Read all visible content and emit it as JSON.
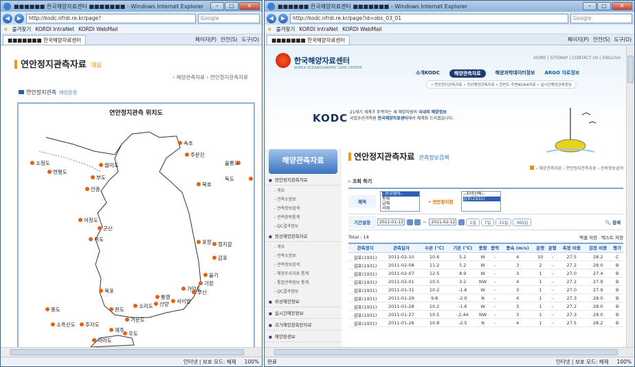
{
  "left_window": {
    "title": "■■■■■■ 한국해양자료센터 ■■■■■■■ - Windows Internet Explorer",
    "url": "http://kodc.nfrdi.re.kr/page?",
    "search_placeholder": "Google",
    "favorites": [
      "즐겨찾기",
      "KORDI IntraNet",
      "KORDI WebMail"
    ],
    "tab_label": "■■■■■■■ 한국해양자료센터",
    "tools": [
      "페이지(P)",
      "안전(S)",
      "도구(O)"
    ],
    "page_title": "연안정지관측자료",
    "page_subtitle": "개요",
    "breadcrumb": "› 해양관측자료 › 연안정지관측자료",
    "tab_active": "연안정지관측",
    "tab_second": "해양환경",
    "map_title": "연안정지관측 위치도",
    "stations": [
      "속초",
      "주문진",
      "울릉도",
      "독도",
      "묵호",
      "소청도",
      "연평도",
      "월미도",
      "부도",
      "안흥",
      "어청도",
      "군산",
      "위도",
      "포항",
      "정지갈",
      "감포",
      "울기",
      "기장",
      "가덕도",
      "부산",
      "통영",
      "서이말",
      "산양",
      "소리도",
      "거문도",
      "목포",
      "완도",
      "홍도",
      "소흑산도",
      "추자도",
      "제주",
      "우도",
      "마라도"
    ],
    "status": "인터넷 | 보호 모드: 해제",
    "zoom": "100%"
  },
  "right_window": {
    "title": "■■■■■■ 한국해양자료센터 ■■■■■■■ - Windows Internet Explorer",
    "url": "http://kodc.nfrdi.re.kr/page?id=obs_03_01",
    "search_placeholder": "Google",
    "favorites": [
      "즐겨찾기",
      "KORDI IntraNet",
      "KORDI WebMail"
    ],
    "tab_label": "■■■■■■■ 한국해양자료센터",
    "tools": [
      "페이지(P)",
      "안전(S)",
      "도구(O)"
    ],
    "logo_text": "한국해양자료센터",
    "logo_en": "KOREA OCEANOGRAPHIC DATA CENTER",
    "top_links": "HOME | SITEMAP | CONTACT US | ENGLISH",
    "gnb": [
      "소개KODC",
      "해양관측자료",
      "해양과학데이터정보",
      "ARGO 자료정보"
    ],
    "subgnb": "• 연안정지관측자료 • 정선해양관측자료 • 한반도 주변NOAA자료 • 실시간해양관측정보",
    "kodc_word": "KODC",
    "slogan_line1_pre": "21세기 세계가 주목하는 새 해양자원의",
    "slogan_bold1": "국내외 해양정보",
    "slogan_line2_pre": "국립수산과학원",
    "slogan_bold2": "한국해양자료센터",
    "slogan_line2_post": "에서 체계화 드리겠습니다.",
    "sidebar_banner": "해양관측자료",
    "sidebar": [
      {
        "label": "연안정지관측자료",
        "subs": [
          "개요",
          "관측소정보",
          "관측정보검색",
          "관측항목통계",
          "QC결과정보"
        ]
      },
      {
        "label": "정선해양관측자료",
        "subs": [
          "개요",
          "관측소정보",
          "관측정보검색",
          "해양조사자료 통계",
          "통합관측정보 통계",
          "QC결과정보"
        ]
      },
      {
        "label": "위성해양정보",
        "subs": []
      },
      {
        "label": "실시간해양정보",
        "subs": []
      },
      {
        "label": "국가해양관측망자료",
        "subs": []
      },
      {
        "label": "해양환경보",
        "subs": []
      }
    ],
    "content_title": "연안정지관측자료",
    "content_subtitle": "관측정보검색",
    "breadcrumb": "› 해양관측자료 › 연안정지관측자료 › 관측정보검색",
    "section_label": "조회 하기",
    "field_sea": "해역",
    "sea_options": [
      "--전국해역--",
      "동해",
      "남해",
      "서해"
    ],
    "field_station": "연안정지점",
    "station_options": [
      "--지역선택--",
      "감포(1931)"
    ],
    "field_period": "기간설정",
    "date_from": "2011-01-13",
    "date_to": "2011-02-12",
    "period_buttons": [
      "1일",
      "7일",
      "31일",
      "365일"
    ],
    "search_button": "검색",
    "count_label": "Total : 14",
    "excel_button": "엑셀 저장",
    "text_button": "텍스트 저장",
    "columns": [
      "관측정지",
      "관측일자",
      "수온 (℃)",
      "기온 (℃)",
      "풍향",
      "풍력",
      "풍속 (m/s)",
      "운량",
      "운형",
      "측정 비중",
      "검정 비중",
      "평가"
    ],
    "rows": [
      [
        "감포(1931)",
        "2011-02-10",
        "10.6",
        "5.2",
        "W",
        "-",
        "4",
        "10",
        "-",
        "27.5",
        "28.2",
        "C"
      ],
      [
        "감포(1931)",
        "2011-02-08",
        "11.2",
        "5.2",
        "W",
        "-",
        "3",
        "2",
        "-",
        "27.2",
        "28.0",
        "B"
      ],
      [
        "감포(1931)",
        "2011-02-07",
        "12.5",
        "8.9",
        "W",
        "-",
        "3",
        "1",
        "-",
        "27.0",
        "27.4",
        "B"
      ],
      [
        "감포(1931)",
        "2011-02-01",
        "10.5",
        "3.2",
        "NW",
        "-",
        "4",
        "1",
        "-",
        "27.2",
        "27.9",
        "B"
      ],
      [
        "감포(1931)",
        "2011-01-31",
        "10.2",
        "-1.6",
        "W",
        "-",
        "3",
        "1",
        "-",
        "27.0",
        "27.9",
        "B"
      ],
      [
        "감포(1931)",
        "2011-01-29",
        "9.8",
        "-2.0",
        "N",
        "-",
        "4",
        "1",
        "-",
        "27.3",
        "28.0",
        "B"
      ],
      [
        "감포(1931)",
        "2011-01-28",
        "10.2",
        "-1.6",
        "W",
        "-",
        "3",
        "1",
        "-",
        "27.2",
        "28.0",
        "B"
      ],
      [
        "감포(1931)",
        "2011-01-27",
        "10.5",
        "-2.44",
        "NW",
        "-",
        "3",
        "1",
        "-",
        "27.3",
        "28.0",
        "B"
      ],
      [
        "감포(1931)",
        "2011-01-26",
        "10.8",
        "-2.5",
        "N",
        "-",
        "4",
        "1",
        "-",
        "27.5",
        "28.2",
        "B"
      ]
    ],
    "status_left": "완료",
    "status": "인터넷 | 보호 모드: 해제",
    "zoom": "100%"
  },
  "colors": {
    "accent_orange": "#f39c12",
    "navy": "#1c3d73",
    "link_blue": "#2256a1",
    "station_dot": "#e8600a"
  }
}
